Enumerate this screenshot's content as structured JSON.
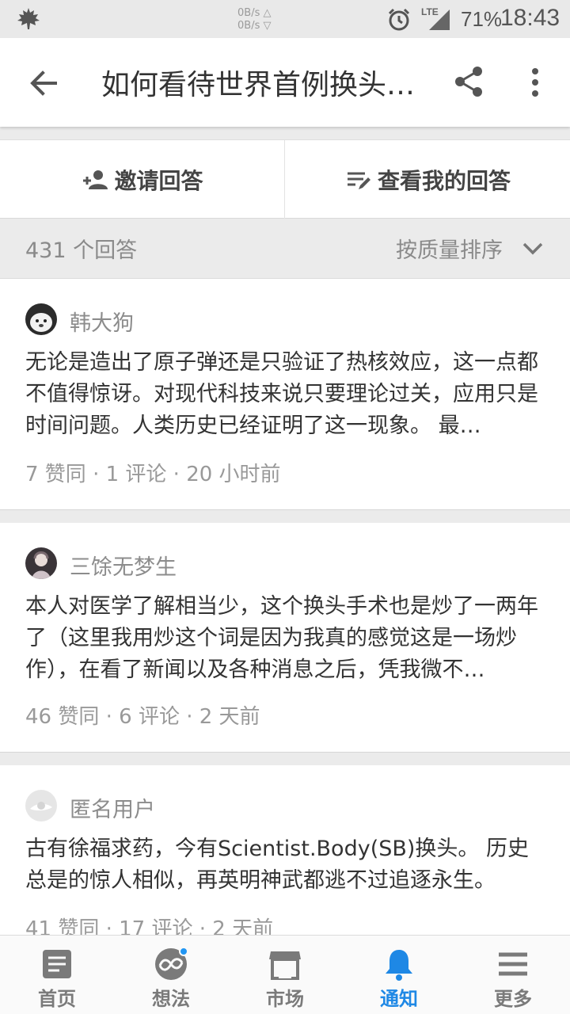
{
  "status_bar": {
    "net_up": "0B/s △",
    "net_down": "0B/s ▽",
    "network": "LTE",
    "battery": "71%",
    "time": "18:43"
  },
  "app_bar": {
    "title": "如何看待世界首例换头手术"
  },
  "actions": {
    "invite_label": "邀请回答",
    "my_answer_label": "查看我的回答"
  },
  "sort": {
    "count_label": "431 个回答",
    "sort_label": "按质量排序"
  },
  "answers": [
    {
      "author": "韩大狗",
      "excerpt": "无论是造出了原子弹还是只验证了热核效应，这一点都不值得惊讶。对现代科技来说只要理论过关，应用只是时间问题。人类历史已经证明了这一现象。 最…",
      "meta": "7 赞同 · 1 评论 · 20 小时前"
    },
    {
      "author": "三馀无梦生",
      "excerpt": "本人对医学了解相当少，这个换头手术也是炒了一两年了（这里我用炒这个词是因为我真的感觉这是一场炒作），在看了新闻以及各种消息之后，凭我微不…",
      "meta": "46 赞同 · 6 评论 · 2 天前"
    },
    {
      "author": "匿名用户",
      "excerpt": "古有徐福求药，今有Scientist.Body(SB)换头。 历史总是的惊人相似，再英明神武都逃不过追逐永生。",
      "meta": "41 赞同 · 17 评论 · 2 天前"
    }
  ],
  "bottom_nav": [
    {
      "label": "首页",
      "icon": "home-icon"
    },
    {
      "label": "想法",
      "icon": "ideas-icon"
    },
    {
      "label": "市场",
      "icon": "market-icon"
    },
    {
      "label": "通知",
      "icon": "bell-icon"
    },
    {
      "label": "更多",
      "icon": "menu-icon"
    }
  ],
  "colors": {
    "accent": "#1e88e5",
    "nav_inactive": "#7a7a7a"
  }
}
